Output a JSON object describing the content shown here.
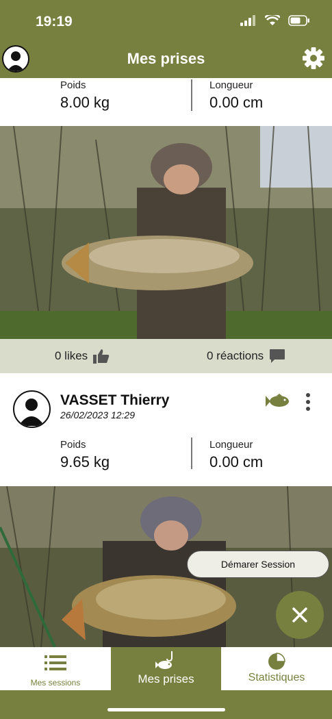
{
  "status": {
    "time": "19:19"
  },
  "header": {
    "title": "Mes prises"
  },
  "post1": {
    "weight_label": "Poids",
    "weight_value": "8.00 kg",
    "length_label": "Longueur",
    "length_value": "0.00 cm",
    "likes": "0 likes",
    "reactions": "0 réactions"
  },
  "post2": {
    "user": "VASSET Thierry",
    "date": "26/02/2023 12:29",
    "weight_label": "Poids",
    "weight_value": "9.65 kg",
    "length_label": "Longueur",
    "length_value": "0.00 cm"
  },
  "start_session": "Démarer Session",
  "tabs": [
    {
      "label": "Mes sessions",
      "icon": "list-icon",
      "active": false
    },
    {
      "label": "Mes prises",
      "icon": "fish-hook-icon",
      "active": true
    },
    {
      "label": "Statistiques",
      "icon": "pie-chart-icon",
      "active": false
    }
  ],
  "colors": {
    "brand": "#77803e",
    "likes_bar": "#d9dccb"
  }
}
